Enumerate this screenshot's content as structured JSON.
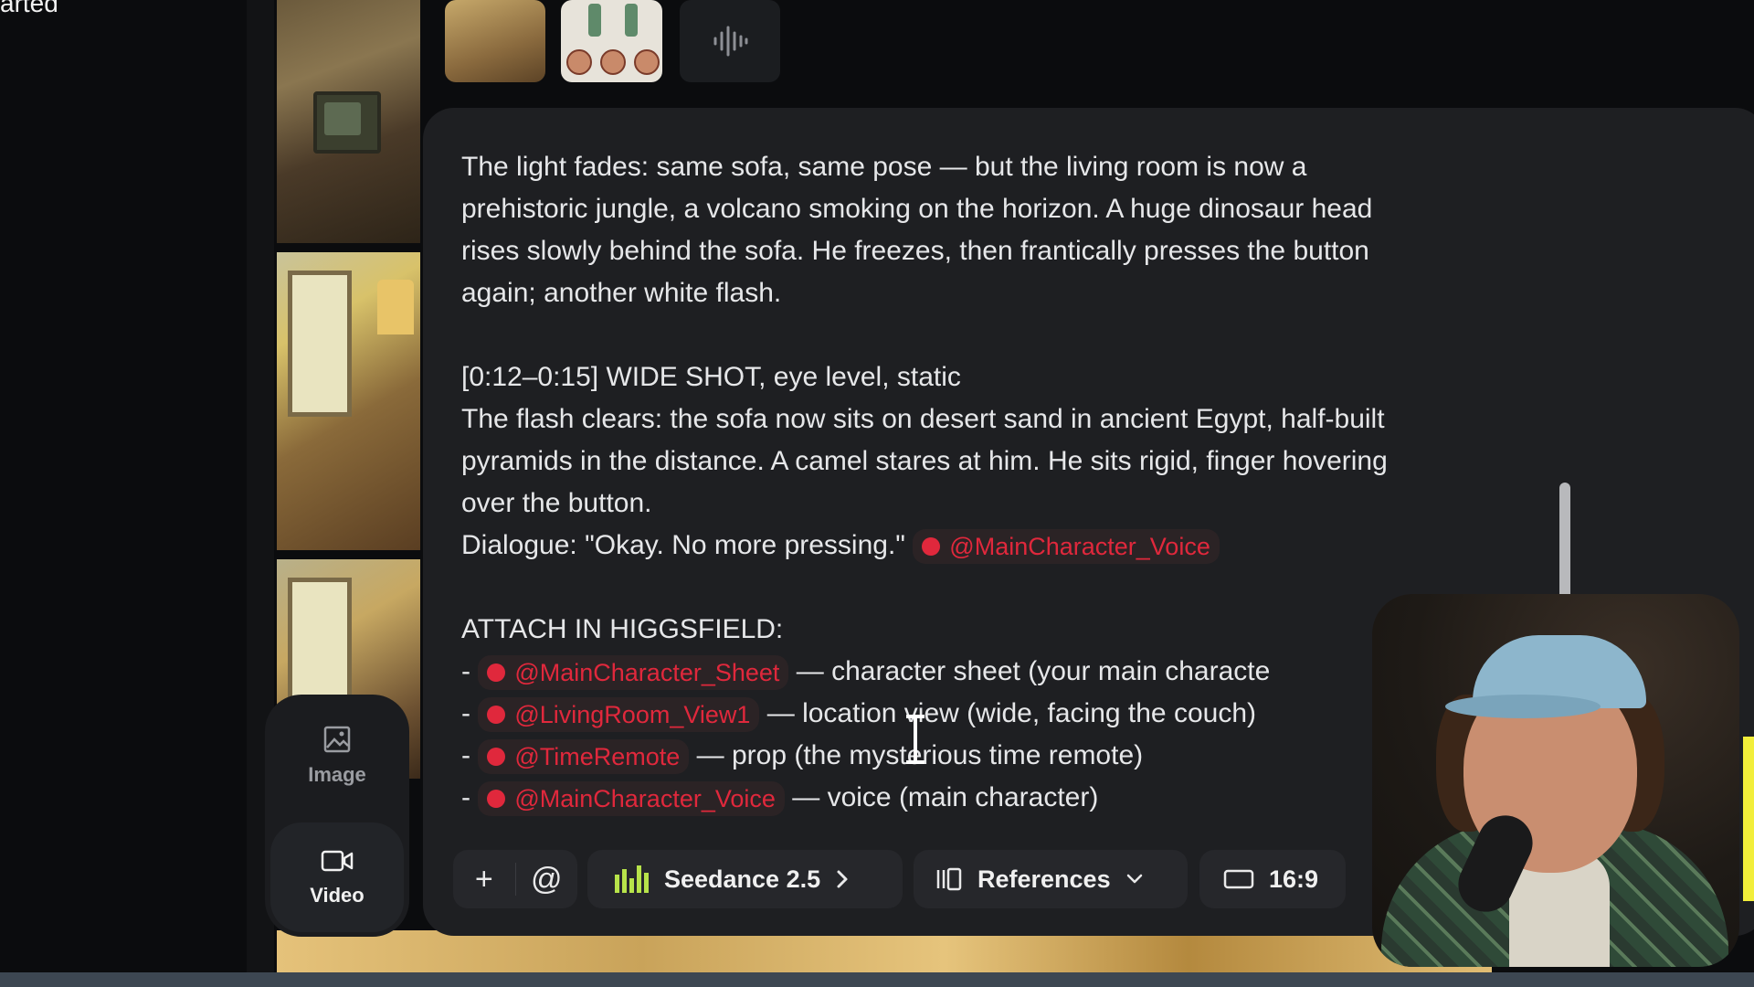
{
  "left_panel": {
    "partial_text": "arted"
  },
  "mode_toggle": {
    "image_label": "Image",
    "video_label": "Video",
    "selected": "Video"
  },
  "prompt": {
    "lines": [
      "The light fades: same sofa, same pose — but the living room is now a",
      "prehistoric jungle, a volcano smoking on the horizon. A huge dinosaur head",
      "rises slowly behind the sofa. He freezes, then frantically presses the button",
      "again; another white flash.",
      "[0:12–0:15] WIDE SHOT, eye level, static",
      "The flash clears: the sofa now sits on desert sand in ancient Egypt, half-built",
      "pyramids in the distance. A camel stares at him. He sits rigid, finger hovering",
      "over the button."
    ],
    "dialogue_prefix": "Dialogue: \"Okay. No more pressing.\"",
    "dialogue_tag": "@MainCharacter_Voice",
    "attach_heading": "ATTACH IN HIGGSFIELD:",
    "attachments": [
      {
        "dash": "-",
        "tag": "@MainCharacter_Sheet",
        "desc": "— character sheet (your main characte"
      },
      {
        "dash": "-",
        "tag": "@LivingRoom_View1",
        "desc": "— location view (wide, facing the couch)"
      },
      {
        "dash": "-",
        "tag": "@TimeRemote",
        "desc": "— prop (the mysterious time remote)"
      },
      {
        "dash": "-",
        "tag": "@MainCharacter_Voice",
        "desc": "— voice (main character)"
      }
    ]
  },
  "toolbar": {
    "add_symbol": "+",
    "mention_symbol": "@",
    "model_name": "Seedance 2.5",
    "references_label": "References",
    "aspect_ratio": "16:9"
  },
  "colors": {
    "tag_red": "#e0283c",
    "card_bg": "#1e1f22",
    "model_icon_green": "#b7e34a"
  }
}
